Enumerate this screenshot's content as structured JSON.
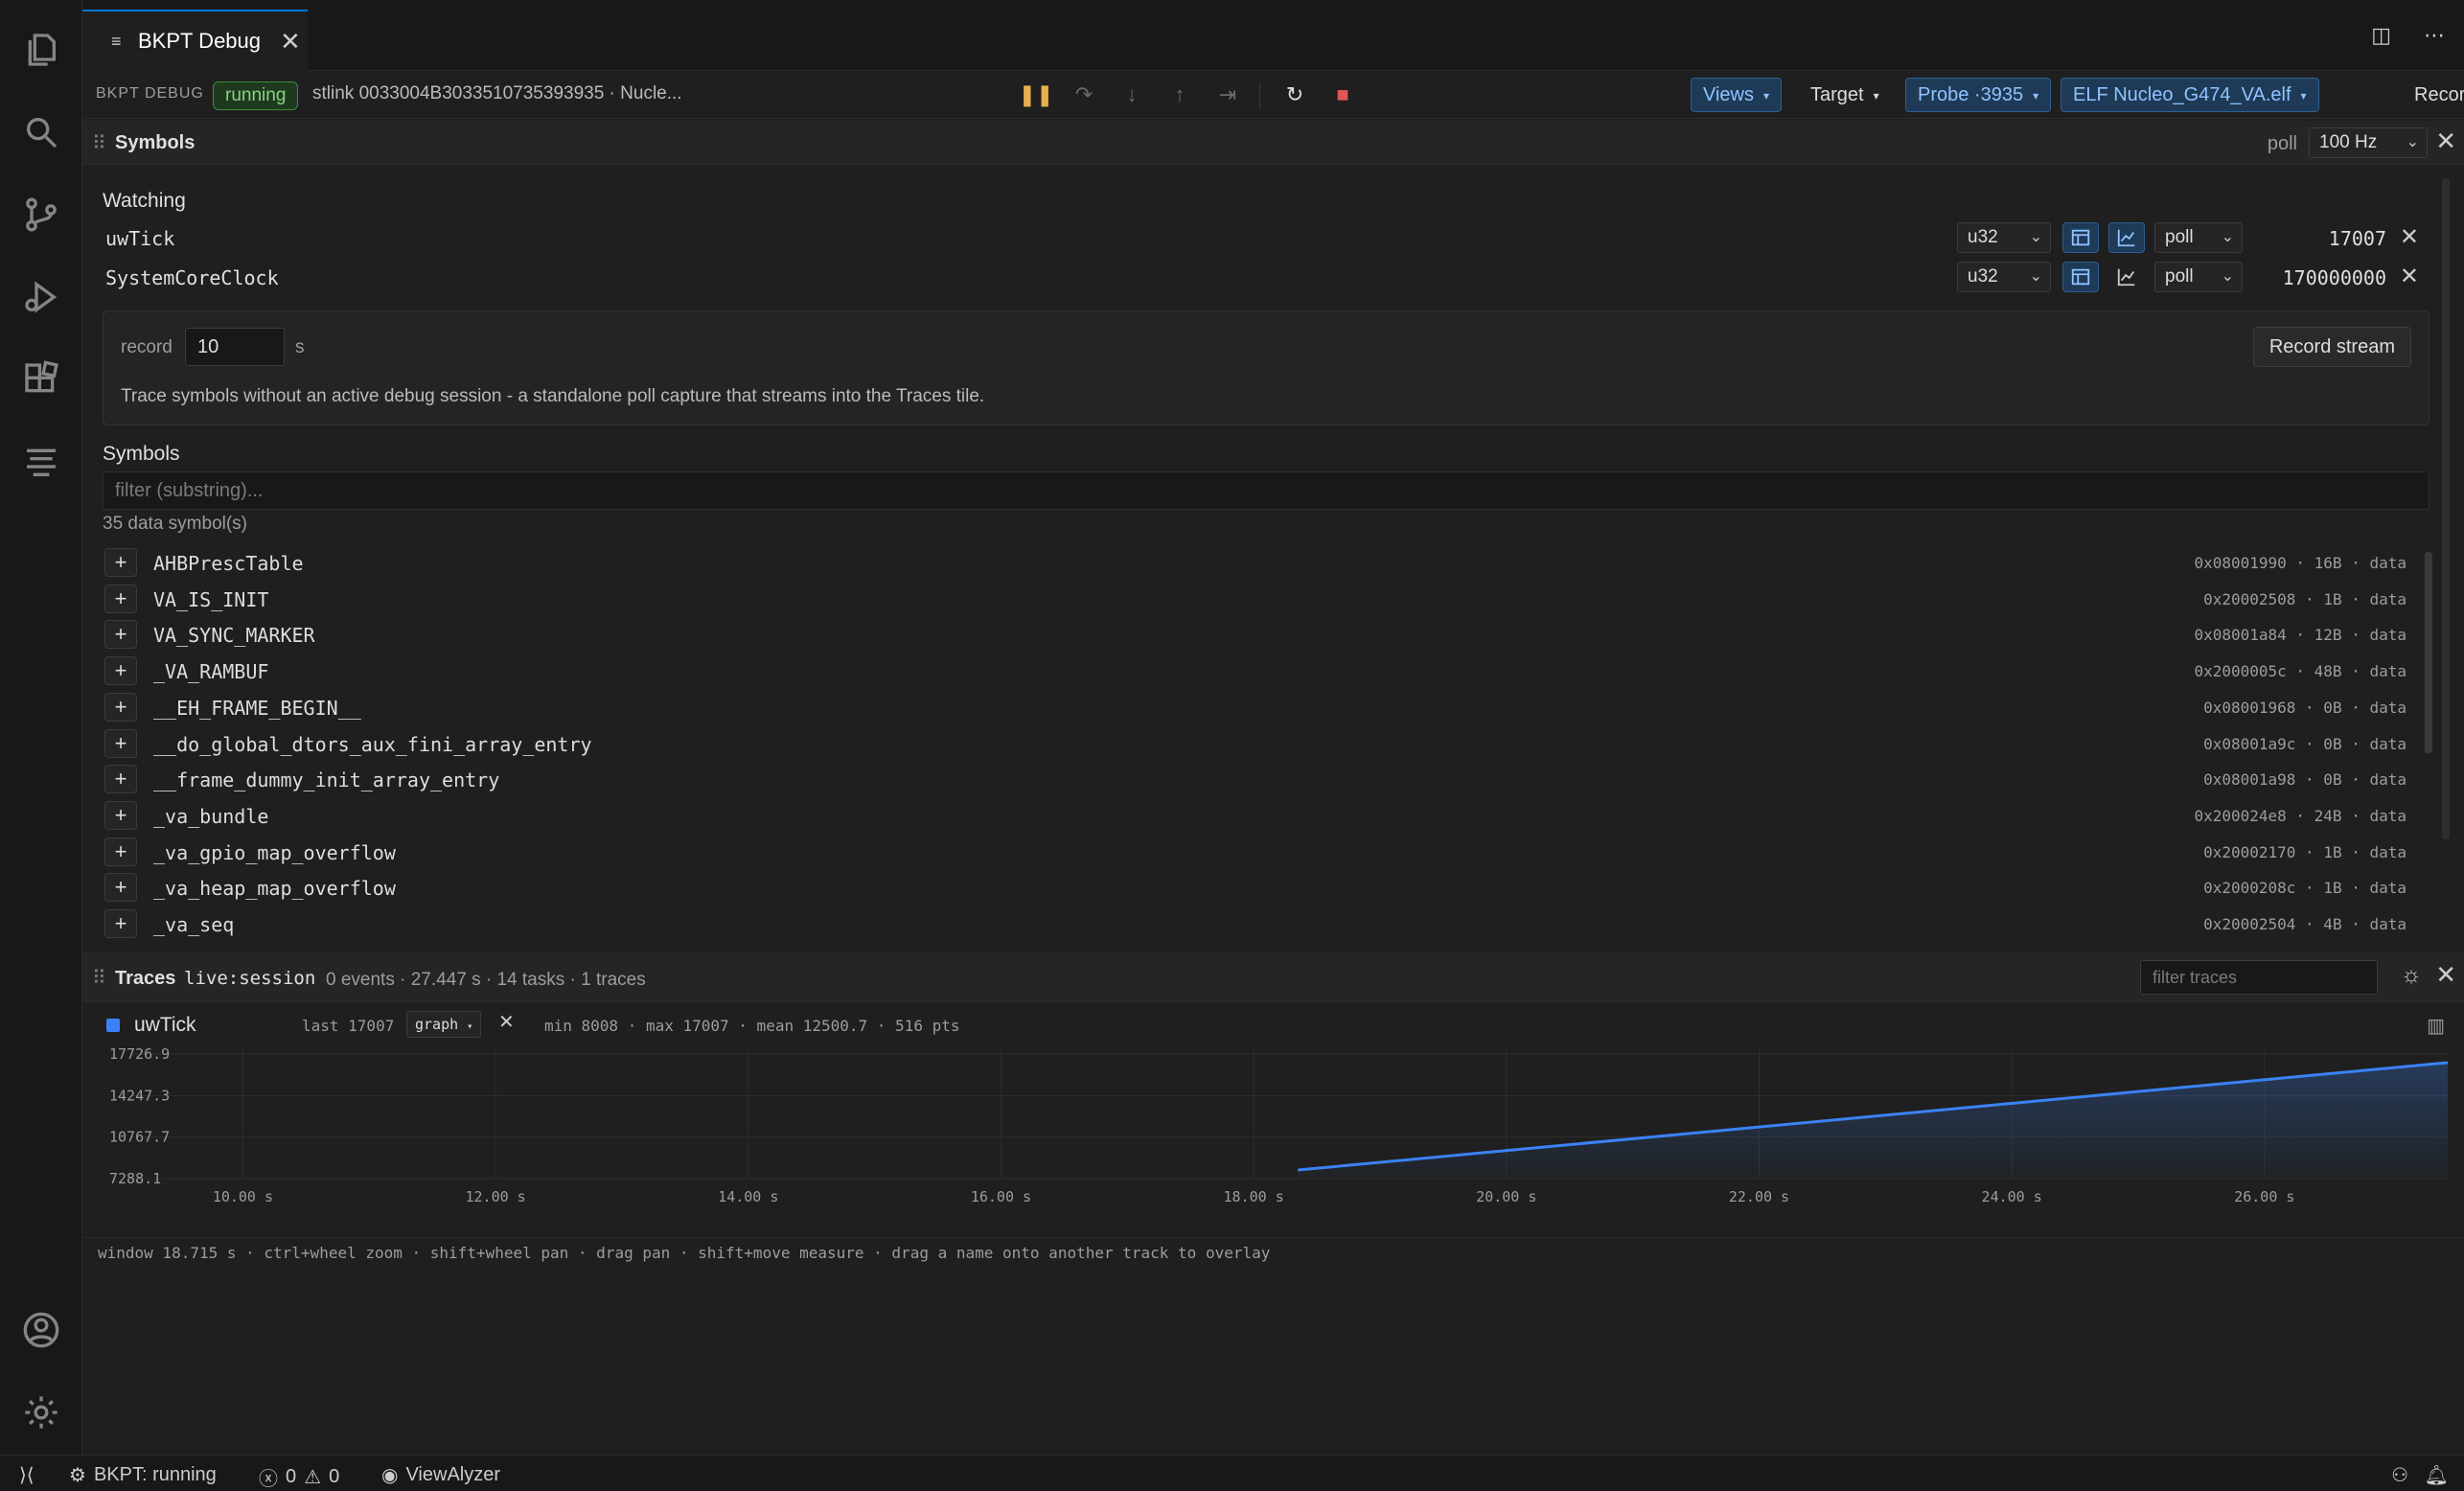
{
  "tab": {
    "title": "BKPT Debug"
  },
  "toolbar": {
    "title": "BKPT DEBUG",
    "status": "running",
    "probe_desc": "stlink 0033004B3033510735393935 · Nucle...",
    "views_label": "Views",
    "target_label": "Target",
    "probe_label": "Probe ·3935",
    "elf_label": "ELF Nucleo_G474_VA.elf",
    "recording_label": "Recording"
  },
  "symbols_panel": {
    "title": "Symbols",
    "poll_label": "poll",
    "poll_rate": "100 Hz",
    "watching_label": "Watching",
    "watches": [
      {
        "name": "uwTick",
        "type": "u32",
        "mode": "poll",
        "value": "17007"
      },
      {
        "name": "SystemCoreClock",
        "type": "u32",
        "mode": "poll",
        "value": "170000000"
      }
    ],
    "record": {
      "label": "record",
      "value": "10",
      "unit": "s",
      "button": "Record stream",
      "hint": "Trace symbols without an active debug session - a standalone poll capture that streams into the Traces tile."
    },
    "symbols_label": "Symbols",
    "filter_placeholder": "filter (substring)...",
    "count": "35 data symbol(s)",
    "symbols": [
      {
        "name": "AHBPrescTable",
        "meta": "0x08001990 · 16B · data"
      },
      {
        "name": "VA_IS_INIT",
        "meta": "0x20002508 · 1B · data"
      },
      {
        "name": "VA_SYNC_MARKER",
        "meta": "0x08001a84 · 12B · data"
      },
      {
        "name": "_VA_RAMBUF",
        "meta": "0x2000005c · 48B · data"
      },
      {
        "name": "__EH_FRAME_BEGIN__",
        "meta": "0x08001968 · 0B · data"
      },
      {
        "name": "__do_global_dtors_aux_fini_array_entry",
        "meta": "0x08001a9c · 0B · data"
      },
      {
        "name": "__frame_dummy_init_array_entry",
        "meta": "0x08001a98 · 0B · data"
      },
      {
        "name": "_va_bundle",
        "meta": "0x200024e8 · 24B · data"
      },
      {
        "name": "_va_gpio_map_overflow",
        "meta": "0x20002170 · 1B · data"
      },
      {
        "name": "_va_heap_map_overflow",
        "meta": "0x2000208c · 1B · data"
      },
      {
        "name": "_va_seq",
        "meta": "0x20002504 · 4B · data"
      }
    ]
  },
  "traces_panel": {
    "title": "Traces",
    "session": "live:session",
    "stats": "0 events · 27.447 s · 14 tasks · 1 traces",
    "filter_placeholder": "filter traces",
    "series": {
      "name": "uwTick",
      "color": "#3b82f6",
      "last": "last 17007",
      "mode": "graph",
      "stats": "min 8008 · max 17007 · mean 12500.7 · 516 pts"
    },
    "footer": "window 18.715 s · ctrl+wheel zoom · shift+wheel pan · drag pan · shift+move measure · drag a name onto another track to overlay"
  },
  "chart_data": {
    "type": "area",
    "x": [
      18.35,
      27.45
    ],
    "series": [
      {
        "name": "uwTick",
        "x": [
          18.35,
          27.45
        ],
        "values": [
          8008,
          17007
        ]
      }
    ],
    "xlim": [
      8.73,
      27.45
    ],
    "ylim": [
      7288.1,
      17726.9
    ],
    "y_ticks": [
      "17726.9",
      "14247.3",
      "10767.7",
      "7288.1"
    ],
    "y_tick_values": [
      17726.9,
      14247.3,
      10767.7,
      7288.1
    ],
    "x_ticks": [
      "10.00 s",
      "12.00 s",
      "14.00 s",
      "16.00 s",
      "18.00 s",
      "20.00 s",
      "22.00 s",
      "24.00 s",
      "26.00 s"
    ],
    "x_tick_values": [
      10,
      12,
      14,
      16,
      18,
      20,
      22,
      24,
      26
    ],
    "grid": true
  },
  "statusbar": {
    "debug_status": "BKPT: running",
    "errors": "0",
    "warnings": "0",
    "extension": "ViewAlyzer"
  }
}
